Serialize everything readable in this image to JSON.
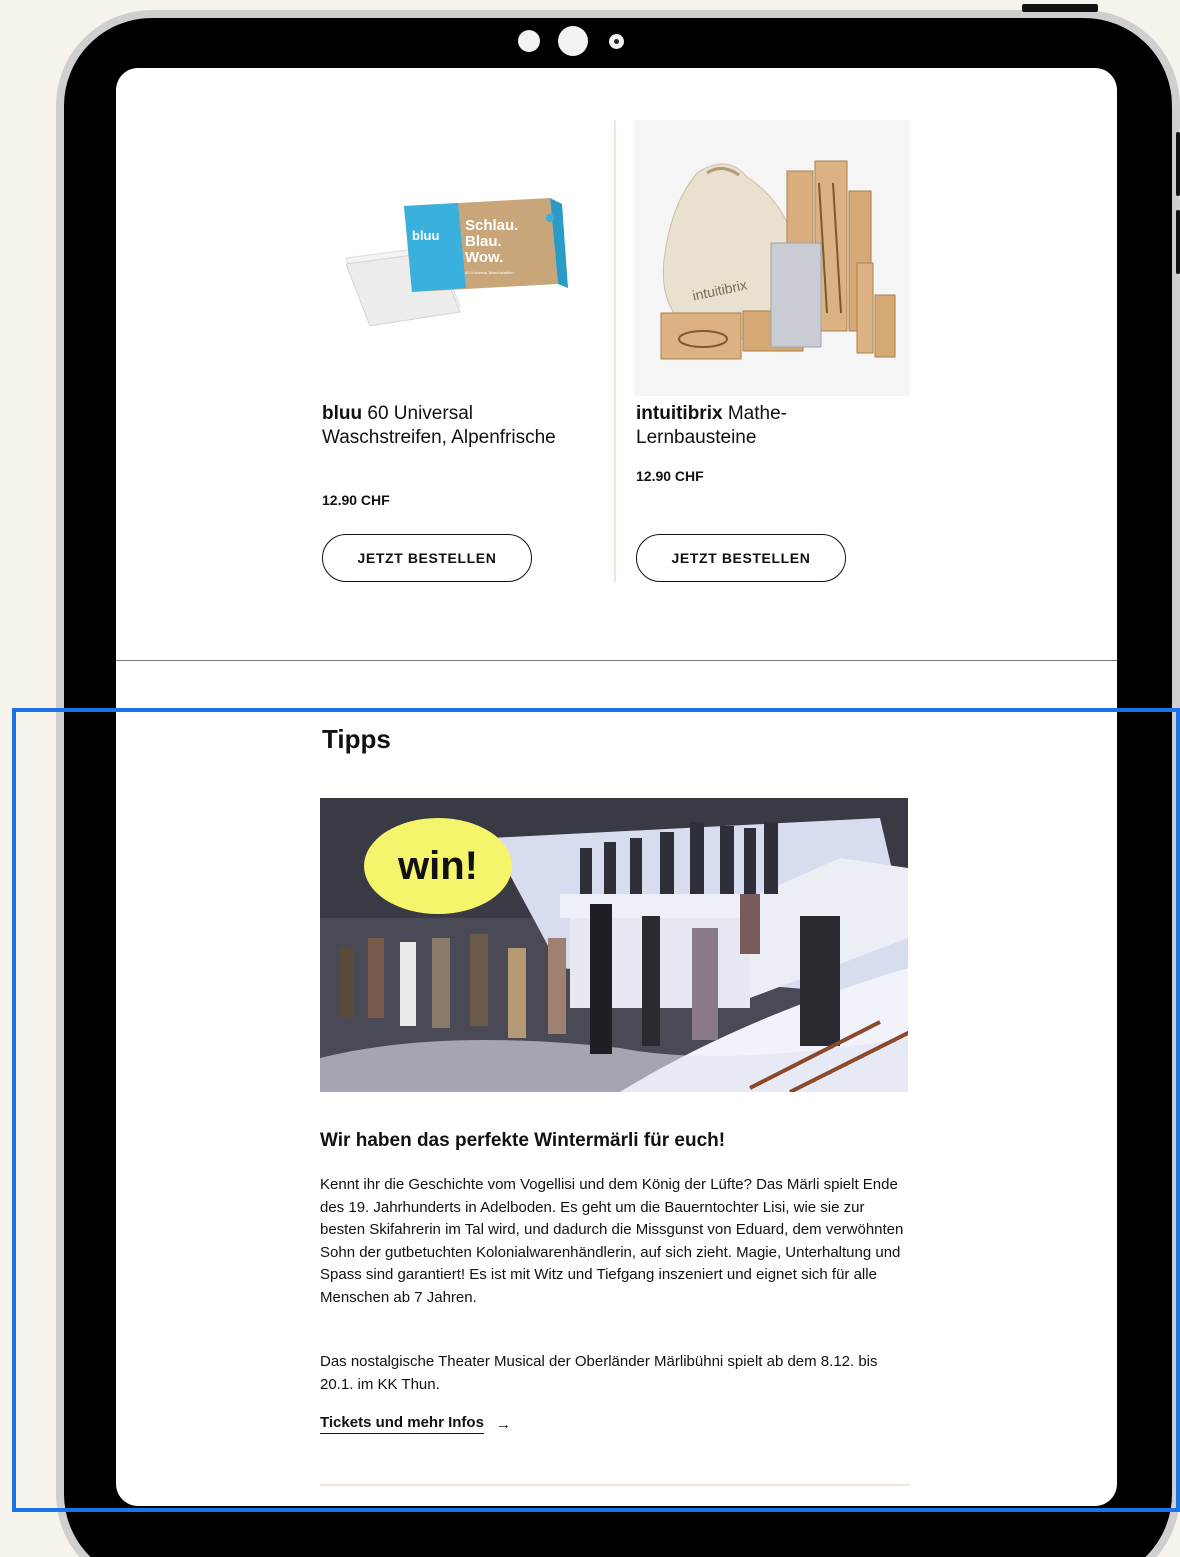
{
  "products": [
    {
      "brand": "bluu",
      "name": " 60 Universal Waschstreifen, Alpenfrische",
      "price": "12.90 CHF",
      "button_label": "JETZT BESTELLEN",
      "package_text": {
        "logo": "bluu",
        "line1": "Schlau.",
        "line2": "Blau.",
        "line3": "Wow.",
        "small": "60 Universal-Waschstreifen"
      }
    },
    {
      "brand": "intuitibrix",
      "name": " Mathe-Lernbausteine",
      "price": "12.90 CHF",
      "button_label": "JETZT BESTELLEN",
      "bag_text": "intuitibrix"
    }
  ],
  "tips": {
    "heading": "Tipps",
    "badge": "win!",
    "article_title": "Wir haben das perfekte Wintermärli für euch!",
    "paragraph1": "Kennt ihr die Geschichte vom Vogellisi und dem König der Lüfte? Das Märli spielt Ende des 19. Jahrhunderts in Adelboden. Es geht um die Bauerntochter Lisi, wie sie zur besten Skifahrerin im Tal wird, und dadurch die Missgunst von Eduard, dem verwöhnten Sohn der gutbetuchten Kolonialwarenhändlerin, auf sich zieht. Magie, Unterhaltung und Spass sind garantiert! Es ist mit Witz und Tiefgang inszeniert und eignet sich für alle Menschen ab 7 Jahren.",
    "paragraph2": "Das nostalgische Theater Musical der Oberländer Märlibühni spielt ab dem 8.12. bis 20.1. im KK Thun.",
    "link_label": "Tickets und mehr Infos",
    "link_arrow": "→"
  },
  "colors": {
    "highlight": "#1a73e8",
    "badge": "#f4f56a",
    "bluu_brand": "#2aa8d8",
    "package_kraft": "#c9a57a"
  }
}
